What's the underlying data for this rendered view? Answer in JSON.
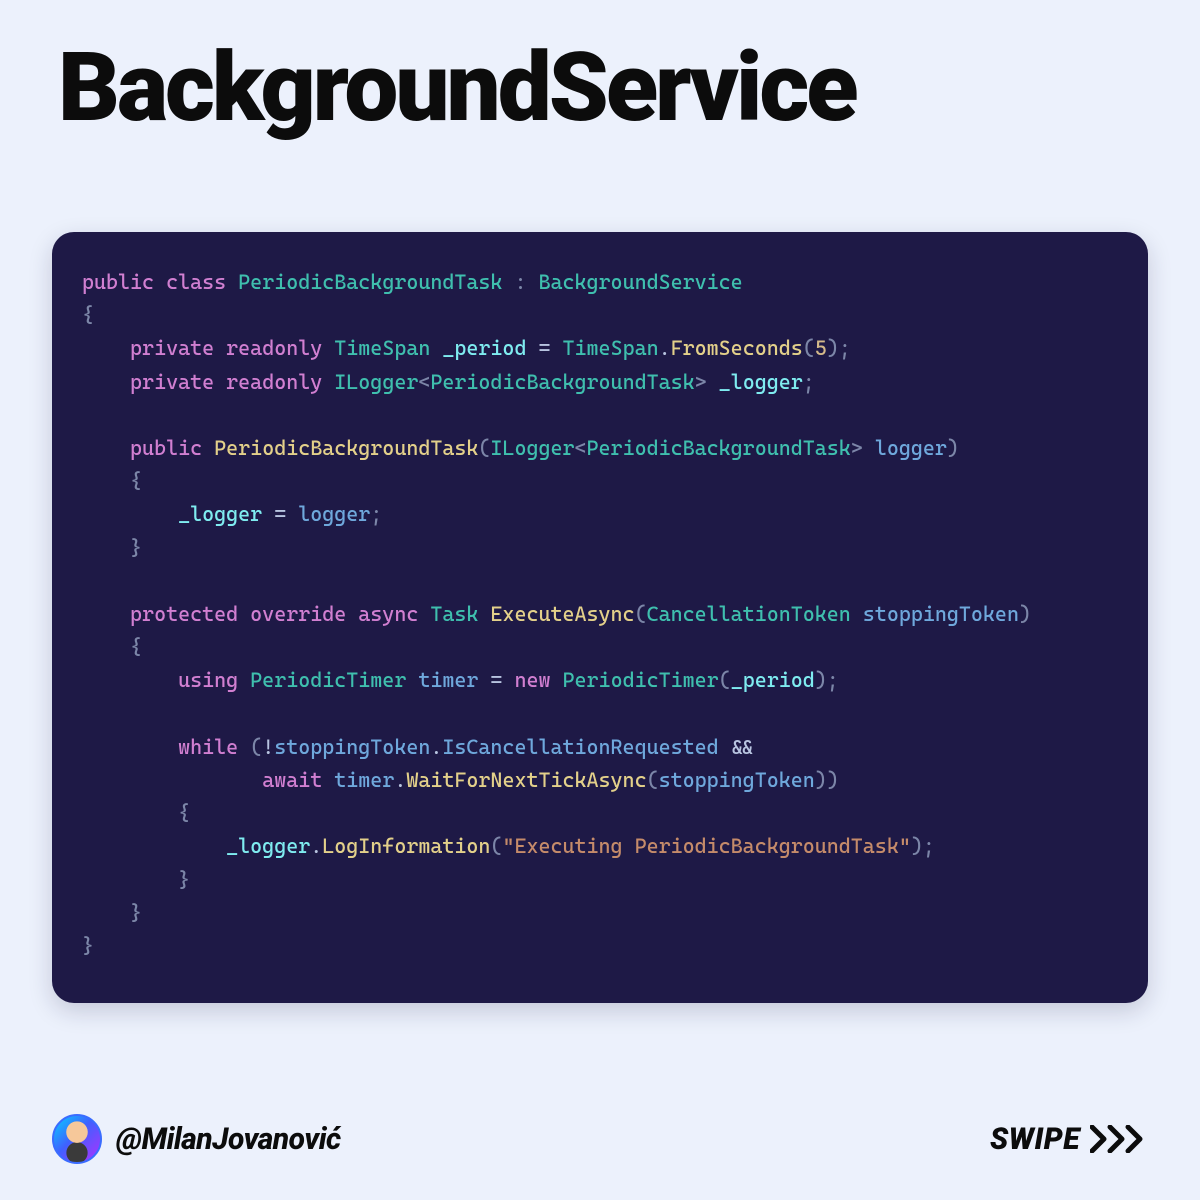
{
  "title": "BackgroundService",
  "author_handle": "@MilanJovanović",
  "swipe_label": "SWIPE",
  "code": {
    "tokens": [
      [
        [
          "kw",
          "public"
        ],
        [
          "",
          ""
        ],
        [
          "kw",
          "class"
        ],
        [
          "",
          ""
        ],
        [
          "type",
          "PeriodicBackgroundTask"
        ],
        [
          "",
          ""
        ],
        [
          "punct",
          ":"
        ],
        [
          "",
          ""
        ],
        [
          "type",
          "BackgroundService"
        ]
      ],
      [
        [
          "punct",
          "{"
        ]
      ],
      [
        [
          "",
          "    "
        ],
        [
          "kw",
          "private"
        ],
        [
          "",
          ""
        ],
        [
          "kw",
          "readonly"
        ],
        [
          "",
          ""
        ],
        [
          "type",
          "TimeSpan"
        ],
        [
          "",
          ""
        ],
        [
          "field",
          "_period"
        ],
        [
          "",
          ""
        ],
        [
          "op",
          "="
        ],
        [
          "",
          ""
        ],
        [
          "type",
          "TimeSpan"
        ],
        [
          "op",
          "."
        ],
        [
          "method",
          "FromSeconds"
        ],
        [
          "punct",
          "("
        ],
        [
          "num",
          "5"
        ],
        [
          "punct",
          ")"
        ],
        [
          "punct",
          ";"
        ]
      ],
      [
        [
          "",
          "    "
        ],
        [
          "kw",
          "private"
        ],
        [
          "",
          ""
        ],
        [
          "kw",
          "readonly"
        ],
        [
          "",
          ""
        ],
        [
          "type",
          "ILogger"
        ],
        [
          "punct",
          "<"
        ],
        [
          "type",
          "PeriodicBackgroundTask"
        ],
        [
          "punct",
          ">"
        ],
        [
          "",
          ""
        ],
        [
          "field",
          "_logger"
        ],
        [
          "punct",
          ";"
        ]
      ],
      [],
      [
        [
          "",
          "    "
        ],
        [
          "kw",
          "public"
        ],
        [
          "",
          ""
        ],
        [
          "method",
          "PeriodicBackgroundTask"
        ],
        [
          "punct",
          "("
        ],
        [
          "type",
          "ILogger"
        ],
        [
          "punct",
          "<"
        ],
        [
          "type",
          "PeriodicBackgroundTask"
        ],
        [
          "punct",
          ">"
        ],
        [
          "",
          ""
        ],
        [
          "var",
          "logger"
        ],
        [
          "punct",
          ")"
        ]
      ],
      [
        [
          "",
          "    "
        ],
        [
          "punct",
          "{"
        ]
      ],
      [
        [
          "",
          "        "
        ],
        [
          "field",
          "_logger"
        ],
        [
          "",
          ""
        ],
        [
          "op",
          "="
        ],
        [
          "",
          ""
        ],
        [
          "var",
          "logger"
        ],
        [
          "punct",
          ";"
        ]
      ],
      [
        [
          "",
          "    "
        ],
        [
          "punct",
          "}"
        ]
      ],
      [],
      [
        [
          "",
          "    "
        ],
        [
          "kw",
          "protected"
        ],
        [
          "",
          ""
        ],
        [
          "kw",
          "override"
        ],
        [
          "",
          ""
        ],
        [
          "kw",
          "async"
        ],
        [
          "",
          ""
        ],
        [
          "type",
          "Task"
        ],
        [
          "",
          ""
        ],
        [
          "method",
          "ExecuteAsync"
        ],
        [
          "punct",
          "("
        ],
        [
          "type",
          "CancellationToken"
        ],
        [
          "",
          ""
        ],
        [
          "var",
          "stoppingToken"
        ],
        [
          "punct",
          ")"
        ]
      ],
      [
        [
          "",
          "    "
        ],
        [
          "punct",
          "{"
        ]
      ],
      [
        [
          "",
          "        "
        ],
        [
          "kw",
          "using"
        ],
        [
          "",
          ""
        ],
        [
          "type",
          "PeriodicTimer"
        ],
        [
          "",
          ""
        ],
        [
          "var",
          "timer"
        ],
        [
          "",
          ""
        ],
        [
          "op",
          "="
        ],
        [
          "",
          ""
        ],
        [
          "kw",
          "new"
        ],
        [
          "",
          ""
        ],
        [
          "type",
          "PeriodicTimer"
        ],
        [
          "punct",
          "("
        ],
        [
          "field",
          "_period"
        ],
        [
          "punct",
          ")"
        ],
        [
          "punct",
          ";"
        ]
      ],
      [],
      [
        [
          "",
          "        "
        ],
        [
          "kw",
          "while"
        ],
        [
          "",
          ""
        ],
        [
          "punct",
          "("
        ],
        [
          "op",
          "!"
        ],
        [
          "var",
          "stoppingToken"
        ],
        [
          "op",
          "."
        ],
        [
          "var",
          "IsCancellationRequested"
        ],
        [
          "",
          ""
        ],
        [
          "op",
          "&&"
        ]
      ],
      [
        [
          "",
          "               "
        ],
        [
          "kw",
          "await"
        ],
        [
          "",
          ""
        ],
        [
          "var",
          "timer"
        ],
        [
          "op",
          "."
        ],
        [
          "method",
          "WaitForNextTickAsync"
        ],
        [
          "punct",
          "("
        ],
        [
          "var",
          "stoppingToken"
        ],
        [
          "punct",
          ")"
        ],
        [
          "punct",
          ")"
        ]
      ],
      [
        [
          "",
          "        "
        ],
        [
          "punct",
          "{"
        ]
      ],
      [
        [
          "",
          "            "
        ],
        [
          "field",
          "_logger"
        ],
        [
          "op",
          "."
        ],
        [
          "method",
          "LogInformation"
        ],
        [
          "punct",
          "("
        ],
        [
          "str",
          "\"Executing PeriodicBackgroundTask\""
        ],
        [
          "punct",
          ")"
        ],
        [
          "punct",
          ";"
        ]
      ],
      [
        [
          "",
          "        "
        ],
        [
          "punct",
          "}"
        ]
      ],
      [
        [
          "",
          "    "
        ],
        [
          "punct",
          "}"
        ]
      ],
      [
        [
          "punct",
          "}"
        ]
      ]
    ]
  }
}
